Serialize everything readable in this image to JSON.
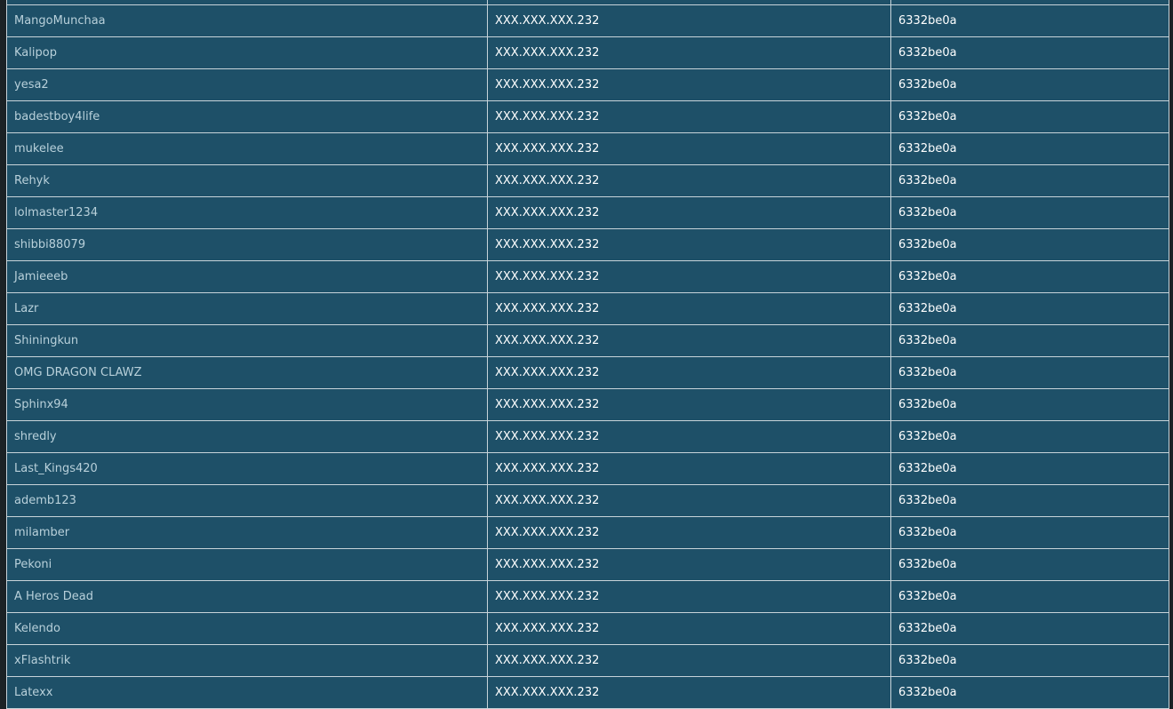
{
  "table": {
    "rows": [
      {
        "username": "MangoMunchaa",
        "ip": "XXX.XXX.XXX.232",
        "hash": "6332be0a"
      },
      {
        "username": "Kalipop",
        "ip": "XXX.XXX.XXX.232",
        "hash": "6332be0a"
      },
      {
        "username": "yesa2",
        "ip": "XXX.XXX.XXX.232",
        "hash": "6332be0a"
      },
      {
        "username": "badestboy4life",
        "ip": "XXX.XXX.XXX.232",
        "hash": "6332be0a"
      },
      {
        "username": "mukelee",
        "ip": "XXX.XXX.XXX.232",
        "hash": "6332be0a"
      },
      {
        "username": "Rehyk",
        "ip": "XXX.XXX.XXX.232",
        "hash": "6332be0a"
      },
      {
        "username": "lolmaster1234",
        "ip": "XXX.XXX.XXX.232",
        "hash": "6332be0a"
      },
      {
        "username": "shibbi88079",
        "ip": "XXX.XXX.XXX.232",
        "hash": "6332be0a"
      },
      {
        "username": "Jamieeeb",
        "ip": "XXX.XXX.XXX.232",
        "hash": "6332be0a"
      },
      {
        "username": "Lazr",
        "ip": "XXX.XXX.XXX.232",
        "hash": "6332be0a"
      },
      {
        "username": "Shiningkun",
        "ip": "XXX.XXX.XXX.232",
        "hash": "6332be0a"
      },
      {
        "username": "OMG DRAGON CLAWZ",
        "ip": "XXX.XXX.XXX.232",
        "hash": "6332be0a"
      },
      {
        "username": "Sphinx94",
        "ip": "XXX.XXX.XXX.232",
        "hash": "6332be0a"
      },
      {
        "username": "shredly",
        "ip": "XXX.XXX.XXX.232",
        "hash": "6332be0a"
      },
      {
        "username": "Last_Kings420",
        "ip": "XXX.XXX.XXX.232",
        "hash": "6332be0a"
      },
      {
        "username": "ademb123",
        "ip": "XXX.XXX.XXX.232",
        "hash": "6332be0a"
      },
      {
        "username": "milamber",
        "ip": "XXX.XXX.XXX.232",
        "hash": "6332be0a"
      },
      {
        "username": "Pekoni",
        "ip": "XXX.XXX.XXX.232",
        "hash": "6332be0a"
      },
      {
        "username": "A Heros Dead",
        "ip": "XXX.XXX.XXX.232",
        "hash": "6332be0a"
      },
      {
        "username": "Kelendo",
        "ip": "XXX.XXX.XXX.232",
        "hash": "6332be0a"
      },
      {
        "username": "xFlashtrik",
        "ip": "XXX.XXX.XXX.232",
        "hash": "6332be0a"
      },
      {
        "username": "Latexx",
        "ip": "XXX.XXX.XXX.232",
        "hash": "6332be0a"
      }
    ]
  },
  "colors": {
    "row_background": "#1e5068",
    "border": "#c8d4da",
    "page_background": "#1c2226"
  }
}
